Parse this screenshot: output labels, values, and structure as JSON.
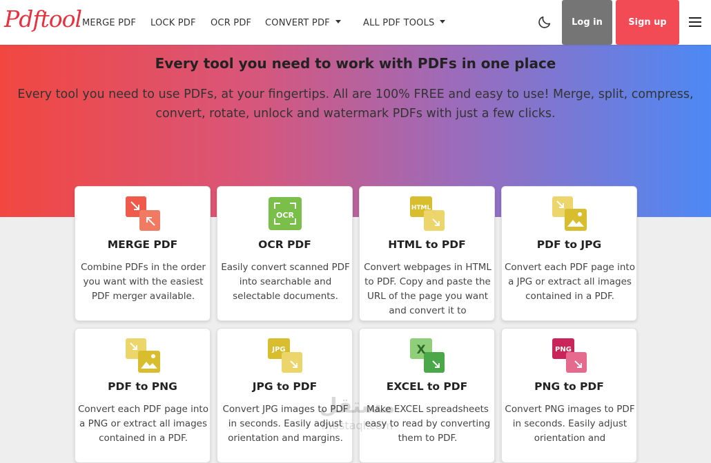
{
  "brand": {
    "logo": "Pdftool"
  },
  "nav": {
    "links": [
      "MERGE PDF",
      "LOCK PDF",
      "OCR PDF",
      "CONVERT PDF",
      "ALL PDF TOOLS"
    ],
    "login": "Log in",
    "signup": "Sign up"
  },
  "hero": {
    "title": "Every tool you need to work with PDFs in one place",
    "subtitle": "Every tool you need to use PDFs, at your fingertips. All are 100% FREE and easy to use! Merge, split, compress, convert, rotate, unlock and watermark PDFs with just a few clicks."
  },
  "cards": [
    {
      "title": "MERGE PDF",
      "desc": "Combine PDFs in the order you want with the easiest PDF merger available.",
      "icon": "merge-icon"
    },
    {
      "title": "OCR PDF",
      "desc": "Easily convert scanned PDF into searchable and selectable documents.",
      "icon": "ocr-icon"
    },
    {
      "title": "HTML to PDF",
      "desc": "Convert webpages in HTML to PDF. Copy and paste the URL of the page you want and convert it to",
      "icon": "html-icon"
    },
    {
      "title": "PDF to JPG",
      "desc": "Convert each PDF page into a JPG or extract all images contained in a PDF.",
      "icon": "image-icon"
    },
    {
      "title": "PDF to PNG",
      "desc": "Convert each PDF page into a PNG or extract all images contained in a PDF.",
      "icon": "image-icon"
    },
    {
      "title": "JPG to PDF",
      "desc": "Convert JPG images to PDF in seconds. Easily adjust orientation and margins.",
      "icon": "jpg-icon"
    },
    {
      "title": "EXCEL to PDF",
      "desc": "Make EXCEL spreadsheets easy to read by converting them to PDF.",
      "icon": "excel-icon"
    },
    {
      "title": "PNG to PDF",
      "desc": "Convert PNG images to PDF in seconds. Easily adjust orientation and",
      "icon": "png-icon"
    }
  ],
  "icon_labels": {
    "ocr": "OCR",
    "html": "HTML",
    "jpg": "JPG",
    "excel": "X",
    "png": "PNG"
  },
  "watermark": {
    "arabic": "مستقل",
    "latin": "mostaql.com"
  },
  "colors": {
    "brand_red": "#e5323f",
    "signup": "#f24b55",
    "login": "#757575",
    "merge": "#ef5a4a",
    "ocr": "#7bbf4b",
    "yellow": "#e0c23c",
    "excel": "#6cbf58",
    "png": "#c9255a"
  }
}
